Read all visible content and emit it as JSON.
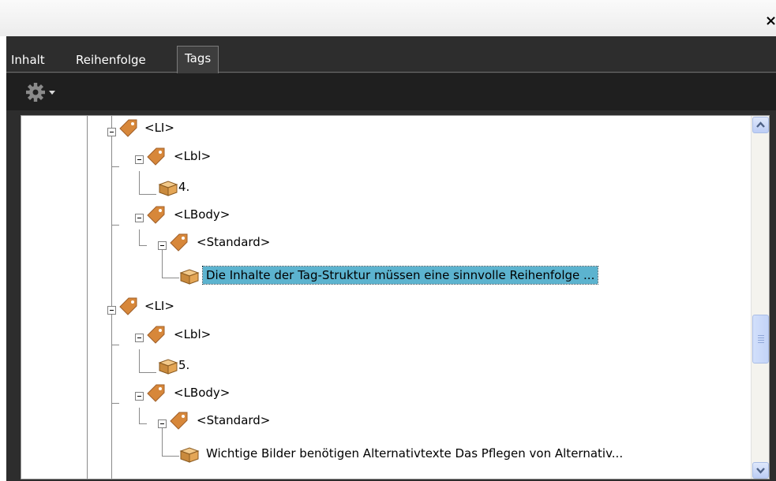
{
  "window": {
    "close_label": "×"
  },
  "tabs": [
    {
      "label": "Inhalt",
      "active": false
    },
    {
      "label": "Reihenfolge",
      "active": false
    },
    {
      "label": "Tags",
      "active": true
    }
  ],
  "toolbar": {
    "options_icon": "gear-icon",
    "options_menu_icon": "chevron-down-icon"
  },
  "tree": {
    "nodes": [
      {
        "type": "tag",
        "label": "<LI>"
      },
      {
        "type": "tag",
        "label": "<Lbl>"
      },
      {
        "type": "content",
        "label": "4."
      },
      {
        "type": "tag",
        "label": "<LBody>"
      },
      {
        "type": "tag",
        "label": "<Standard>"
      },
      {
        "type": "content",
        "label": "Die Inhalte der Tag-Struktur müssen eine sinnvolle Reihenfolge ...",
        "selected": true
      },
      {
        "type": "tag",
        "label": "<LI>"
      },
      {
        "type": "tag",
        "label": "<Lbl>"
      },
      {
        "type": "content",
        "label": "5."
      },
      {
        "type": "tag",
        "label": "<LBody>"
      },
      {
        "type": "tag",
        "label": "<Standard>"
      },
      {
        "type": "content",
        "label": "Wichtige Bilder benötigen Alternativtexte Das Pflegen von Alternativ..."
      }
    ]
  },
  "colors": {
    "panel_bg": "#2d2d2d",
    "toolbar_bg": "#1f1f1f",
    "selection": "#5cb3cf",
    "tag_icon": "#d7873a"
  }
}
